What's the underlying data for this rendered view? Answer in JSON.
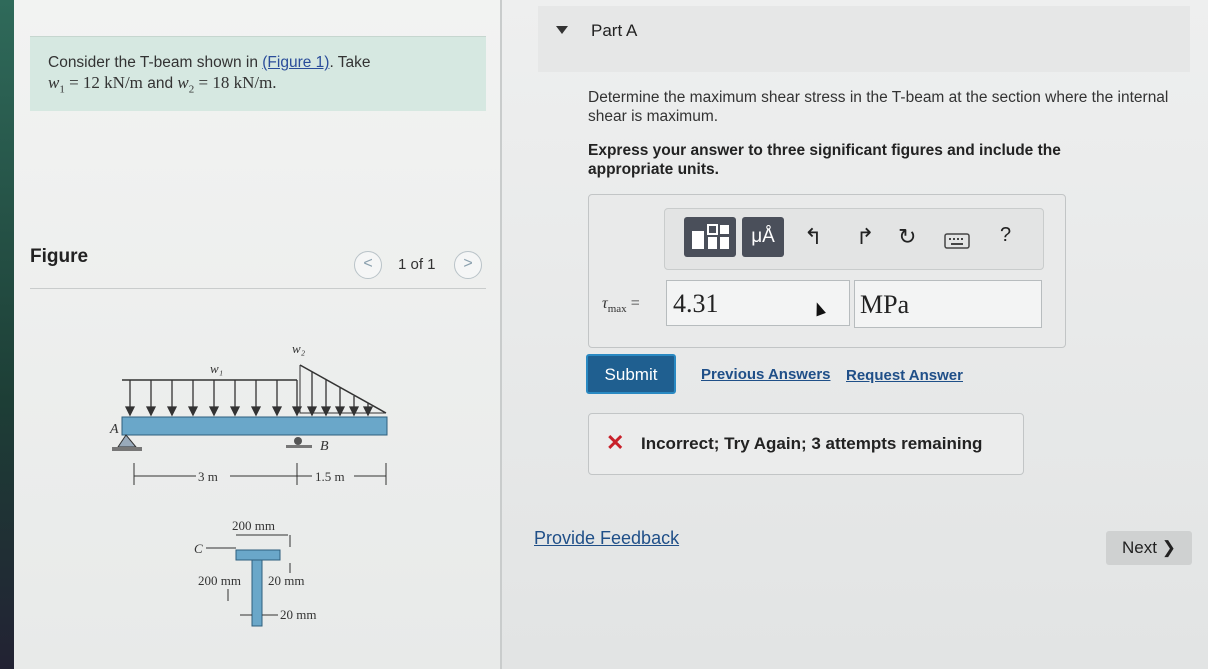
{
  "problem": {
    "text_prefix": "Consider the T-beam shown in ",
    "figure_link": "(Figure 1)",
    "text_suffix": ". Take",
    "w1_sym": "w",
    "w1_sub": "1",
    "w1_value": " = 12 kN/m",
    "and_word": " and ",
    "w2_sym": "w",
    "w2_sub": "2",
    "w2_value": " = 18 kN/m."
  },
  "figure": {
    "heading": "Figure",
    "page_count": "1 of 1",
    "prev_glyph": "<",
    "next_glyph": ">",
    "labels": {
      "w1": "w₁",
      "w2": "w₂",
      "A": "A",
      "B": "B",
      "C": "C",
      "span1": "3 m",
      "span2": "1.5 m",
      "flange_width": "200 mm",
      "web_depth": "200 mm",
      "flange_thick": "20 mm",
      "web_thick": "20 mm"
    }
  },
  "part": {
    "title": "Part A",
    "question": "Determine the maximum shear stress in the T-beam at the section where the internal shear is maximum.",
    "instruction": "Express your answer to three significant figures and include the appropriate units."
  },
  "toolbar": {
    "units_label": "μÅ",
    "help_label": "?",
    "icons": [
      "templates-icon",
      "units-icon",
      "undo-icon",
      "redo-icon",
      "reset-icon",
      "keyboard-icon",
      "help-icon"
    ]
  },
  "answer": {
    "variable": "τ",
    "variable_sub": "max",
    "equals": "=",
    "value": "4.31",
    "unit": "MPa"
  },
  "actions": {
    "submit": "Submit",
    "previous_answers": "Previous Answers",
    "request_answer": "Request Answer"
  },
  "feedback": {
    "message": "Incorrect; Try Again; 3 attempts remaining",
    "color": "#c8202a"
  },
  "footer": {
    "provide_feedback": "Provide Feedback",
    "next_label": "Next",
    "next_glyph": "❯"
  }
}
